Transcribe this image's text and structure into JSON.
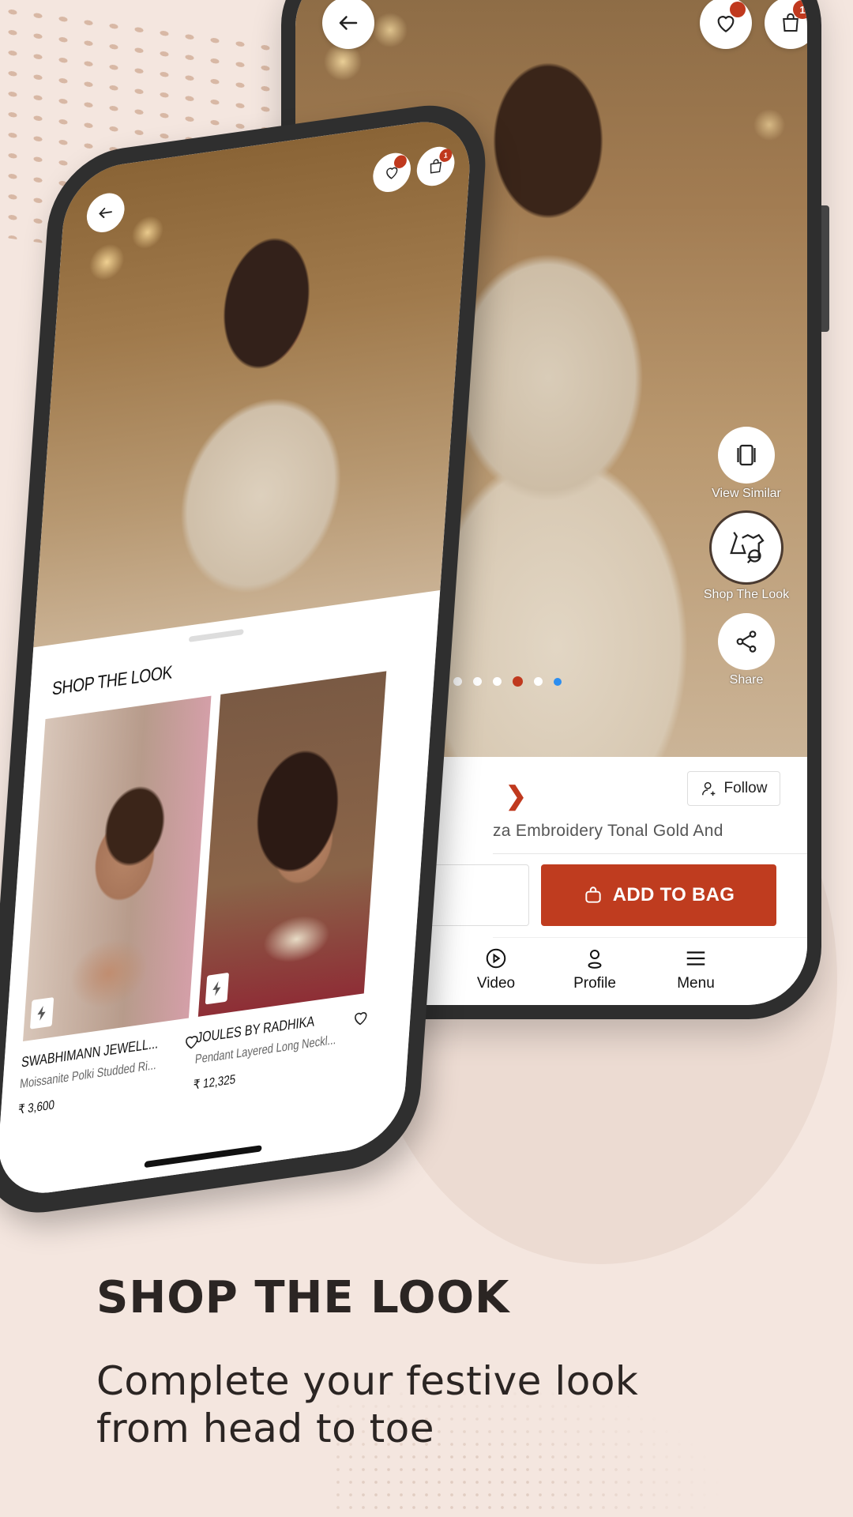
{
  "colors": {
    "background": "#f4e6df",
    "accent": "#c0391e",
    "text_dark": "#2b2523",
    "indicator_active": "#c0391e",
    "indicator_blue": "#2c8ef0"
  },
  "right_phone": {
    "top_bar": {
      "back_icon": "arrow-left-icon",
      "wishlist_icon": "heart-icon",
      "wishlist_dot": true,
      "bag_icon": "bag-icon",
      "bag_count": "1"
    },
    "side_actions": [
      {
        "label": "View Similar",
        "icon": "view-similar-icon"
      },
      {
        "label": "Shop The Look",
        "icon": "shop-the-look-icon"
      },
      {
        "label": "Share",
        "icon": "share-icon"
      }
    ],
    "carousel": {
      "total": 6,
      "active_index": 3
    },
    "info": {
      "chevron_icon": "chevron-right-icon",
      "follow_label": "Follow",
      "product_title": "za Embroidery Tonal Gold And",
      "add_to_bag_label": "ADD TO BAG"
    },
    "bottom_nav": [
      {
        "label": "Video",
        "icon": "video-icon"
      },
      {
        "label": "Profile",
        "icon": "profile-icon"
      },
      {
        "label": "Menu",
        "icon": "menu-icon"
      }
    ]
  },
  "left_phone": {
    "top_bar": {
      "back_icon": "arrow-left-icon",
      "bag_count": "1"
    },
    "sheet": {
      "title": "SHOP THE LOOK",
      "products": [
        {
          "brand": "SWABHIMANN JEWELL...",
          "description": "Moissanite Polki Studded Ri...",
          "price": "₹ 3,600"
        },
        {
          "brand": "JOULES BY RADHIKA",
          "description": "Pendant Layered Long Neckl...",
          "price": "₹ 12,325"
        }
      ]
    }
  },
  "promo": {
    "headline": "SHOP THE LOOK",
    "subline_1": "Complete your festive look",
    "subline_2": "from head to toe"
  }
}
